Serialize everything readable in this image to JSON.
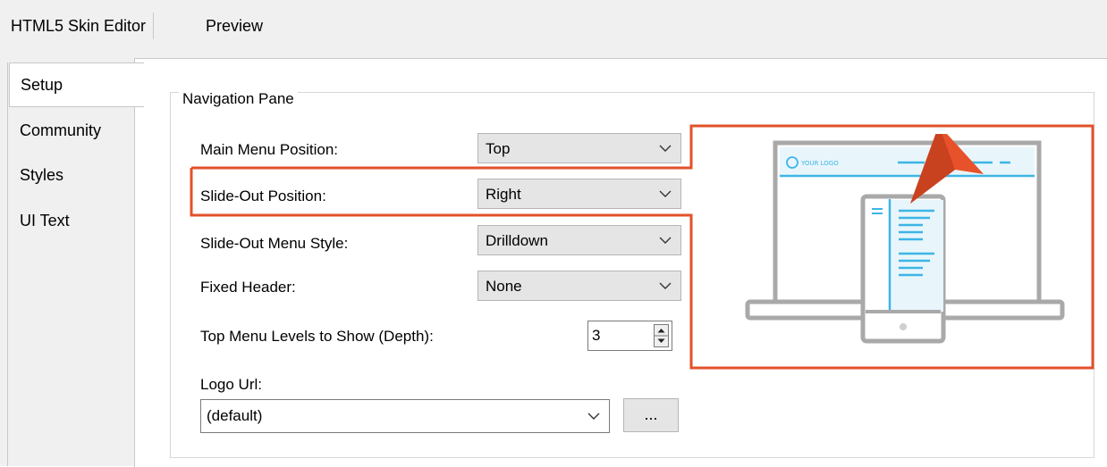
{
  "top_tabs": [
    "HTML5 Skin Editor",
    "Preview"
  ],
  "side_tabs": [
    "Setup",
    "Community",
    "Styles",
    "UI Text"
  ],
  "navigation_pane": {
    "legend": "Navigation Pane",
    "main_menu_position": {
      "label": "Main Menu Position:",
      "value": "Top"
    },
    "slide_out_position": {
      "label": "Slide-Out Position:",
      "value": "Right"
    },
    "slide_out_menu_style": {
      "label": "Slide-Out Menu Style:",
      "value": "Drilldown"
    },
    "fixed_header": {
      "label": "Fixed Header:",
      "value": "None"
    },
    "top_menu_levels": {
      "label": "Top Menu Levels to Show (Depth):",
      "value": "3"
    },
    "logo_url": {
      "label": "Logo Url:",
      "value": "(default)",
      "browse_label": "..."
    }
  },
  "preview": {
    "logo_text": "YOUR LOGO"
  },
  "colors": {
    "highlight": "#e2512a",
    "preview_gray": "#a9a9a9",
    "preview_blue": "#3db5e6",
    "preview_fill": "#e8f6fc"
  }
}
